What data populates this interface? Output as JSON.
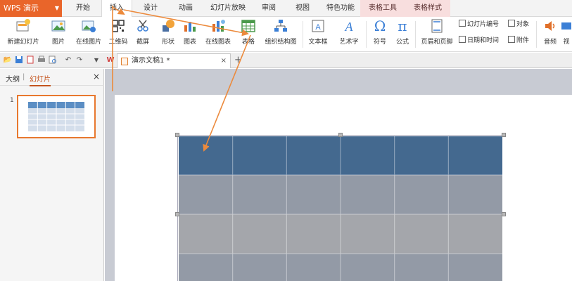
{
  "app": {
    "name": "WPS 演示",
    "brand_color": "#e9652a"
  },
  "menu": {
    "items": [
      {
        "label": "开始"
      },
      {
        "label": "插入"
      },
      {
        "label": "设计"
      },
      {
        "label": "动画"
      },
      {
        "label": "幻灯片放映"
      },
      {
        "label": "审阅"
      },
      {
        "label": "视图"
      },
      {
        "label": "特色功能"
      }
    ],
    "context_items": [
      {
        "label": "表格工具"
      },
      {
        "label": "表格样式"
      }
    ]
  },
  "ribbon": {
    "buttons": [
      {
        "label": "新建幻灯片",
        "icon": "new-slide-icon"
      },
      {
        "label": "图片",
        "icon": "picture-icon"
      },
      {
        "label": "在线图片",
        "icon": "online-picture-icon"
      },
      {
        "label": "二维码",
        "icon": "qr-code-icon"
      },
      {
        "label": "截屏",
        "icon": "screenshot-icon"
      },
      {
        "label": "形状",
        "icon": "shapes-icon"
      },
      {
        "label": "图表",
        "icon": "chart-icon"
      },
      {
        "label": "在线图表",
        "icon": "online-chart-icon"
      },
      {
        "label": "表格",
        "icon": "table-icon"
      },
      {
        "label": "组织结构图",
        "icon": "org-chart-icon"
      },
      {
        "label": "文本框",
        "icon": "textbox-icon"
      },
      {
        "label": "艺术字",
        "icon": "wordart-icon"
      },
      {
        "label": "符号",
        "icon": "symbol-icon"
      },
      {
        "label": "公式",
        "icon": "formula-icon"
      },
      {
        "label": "页眉和页脚",
        "icon": "header-footer-icon"
      },
      {
        "label": "音频",
        "icon": "audio-icon"
      },
      {
        "label": "视",
        "icon": "video-icon"
      }
    ],
    "small": [
      {
        "label": "幻灯片编号"
      },
      {
        "label": "对象"
      },
      {
        "label": "日期和时间"
      },
      {
        "label": "附件"
      }
    ],
    "symbol_glyph": "Ω",
    "formula_glyph": "π"
  },
  "document": {
    "tab_title": "演示文稿1 *",
    "close_glyph": "×",
    "new_tab_glyph": "+"
  },
  "left_panel": {
    "tabs": [
      {
        "label": "大纲"
      },
      {
        "label": "幻灯片"
      }
    ],
    "separator": "|",
    "close_glyph": "×",
    "slide_number": "1"
  },
  "colors": {
    "accent": "#e8782e",
    "table_header": "#44698f",
    "table_row_odd": "#939aa6",
    "table_row_even": "#a4a6ab",
    "arrow": "#ec8a3c"
  }
}
